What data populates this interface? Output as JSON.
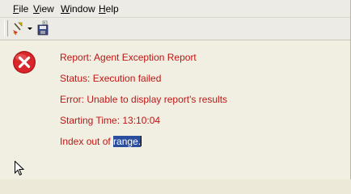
{
  "menu": {
    "items": [
      {
        "mnemonic": "F",
        "rest": "ile"
      },
      {
        "mnemonic": "V",
        "rest": "iew"
      },
      {
        "mnemonic": "W",
        "rest": "indow"
      },
      {
        "mnemonic": "H",
        "rest": "elp"
      }
    ]
  },
  "toolbar": {
    "icons": [
      "run-report-icon",
      "dropdown-arrow-icon",
      "save-report-icon"
    ]
  },
  "message": {
    "icon": "error-icon",
    "color": "#c01414",
    "report": "Report: Agent Exception Report",
    "status": "Status: Execution failed",
    "error": "Error: Unable to display report's results",
    "starting_time": "Starting Time: 13:10:04",
    "index_prefix": "Index out of ",
    "index_selected": "range",
    "index_suffix": "."
  },
  "colors": {
    "selection": "#2a4d9e",
    "error_red": "#c01414"
  }
}
